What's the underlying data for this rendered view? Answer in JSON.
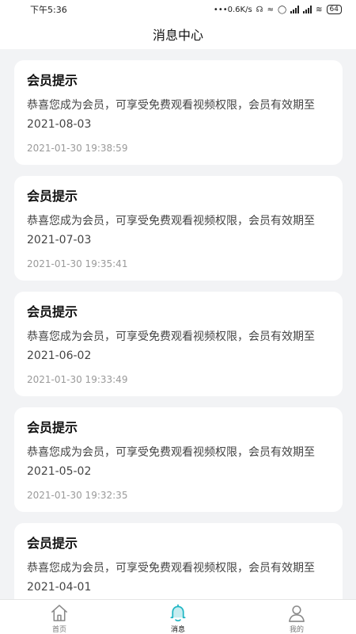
{
  "status": {
    "time": "下午5:36",
    "net_speed": "•••0.6K/s",
    "battery": "64"
  },
  "header": {
    "title": "消息中心"
  },
  "messages": [
    {
      "title": "会员提示",
      "body": "恭喜您成为会员，可享受免费观看视频权限，会员有效期至2021-08-03",
      "time": "2021-01-30 19:38:59"
    },
    {
      "title": "会员提示",
      "body": "恭喜您成为会员，可享受免费观看视频权限，会员有效期至2021-07-03",
      "time": "2021-01-30 19:35:41"
    },
    {
      "title": "会员提示",
      "body": "恭喜您成为会员，可享受免费观看视频权限，会员有效期至2021-06-02",
      "time": "2021-01-30 19:33:49"
    },
    {
      "title": "会员提示",
      "body": "恭喜您成为会员，可享受免费观看视频权限，会员有效期至2021-05-02",
      "time": "2021-01-30 19:32:35"
    },
    {
      "title": "会员提示",
      "body": "恭喜您成为会员，可享受免费观看视频权限，会员有效期至2021-04-01",
      "time": ""
    }
  ],
  "tabbar": {
    "active_color": "#1fb6c4",
    "items": [
      {
        "label": "首页",
        "icon": "home-icon"
      },
      {
        "label": "消息",
        "icon": "bell-icon"
      },
      {
        "label": "我的",
        "icon": "user-icon"
      }
    ]
  }
}
